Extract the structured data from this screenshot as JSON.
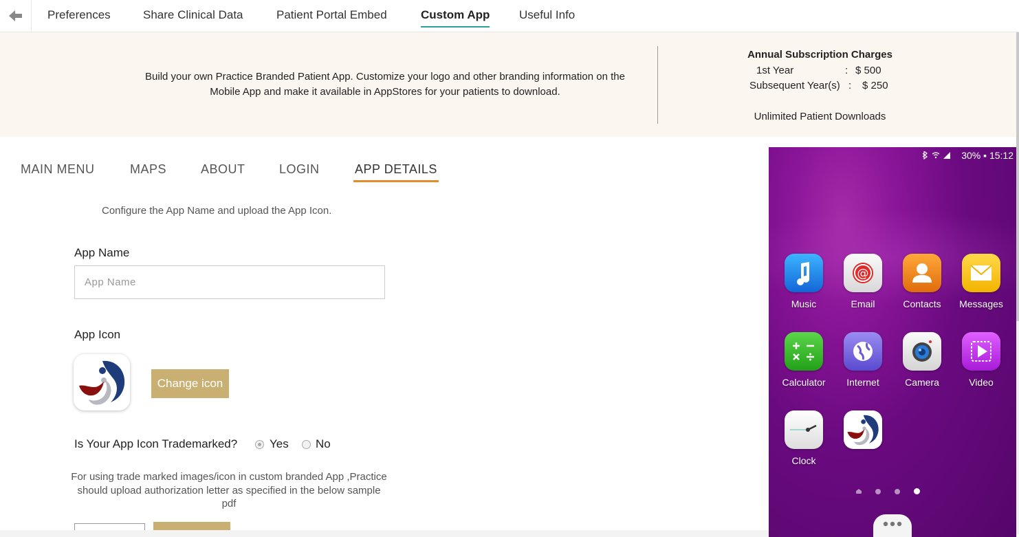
{
  "top_nav": {
    "tabs": [
      {
        "label": "Preferences"
      },
      {
        "label": "Share Clinical Data"
      },
      {
        "label": "Patient Portal Embed"
      },
      {
        "label": "Custom App"
      },
      {
        "label": "Useful Info"
      }
    ],
    "active_tab": "Custom App"
  },
  "banner": {
    "line1": "Build your own Practice Branded Patient App. Customize your logo and other branding information on the",
    "line2": "Mobile App and make it available in AppStores for your patients to download.",
    "pricing": {
      "title": "Annual Subscription Charges",
      "first_year_label": "1st Year",
      "first_year_sep": ":",
      "first_year_value": "$ 500",
      "subsequent_label": "Subsequent Year(s)",
      "subsequent_sep": ":",
      "subsequent_value": "$ 250",
      "downloads": "Unlimited Patient Downloads"
    }
  },
  "sub_tabs": {
    "items": [
      {
        "label": "MAIN MENU"
      },
      {
        "label": "MAPS"
      },
      {
        "label": "ABOUT"
      },
      {
        "label": "LOGIN"
      },
      {
        "label": "APP DETAILS"
      }
    ],
    "active": "APP DETAILS"
  },
  "app_details": {
    "description": "Configure the App Name and upload the App Icon.",
    "app_name_label": "App Name",
    "app_name_placeholder": "App Name",
    "app_name_value": "",
    "app_icon_label": "App Icon",
    "change_icon_label": "Change icon",
    "trademark_question": "Is Your App Icon Trademarked?",
    "trademark_yes": "Yes",
    "trademark_no": "No",
    "trademark_selected": "Yes",
    "trademark_note_1": "For using trade marked images/icon in custom branded App ,Practice",
    "trademark_note_2": "should upload authorization letter as specified in the below sample",
    "trademark_note_3": "pdf"
  },
  "phone_preview": {
    "status": "30% ▪ 15:12",
    "apps": [
      {
        "name": "Music",
        "icon": "music-note-icon",
        "color": "#1e90f0"
      },
      {
        "name": "Email",
        "icon": "at-sign-icon",
        "color": "#e8e8e8"
      },
      {
        "name": "Contacts",
        "icon": "person-icon",
        "color": "#f08a1c"
      },
      {
        "name": "Messages",
        "icon": "envelope-icon",
        "color": "#f7c21a"
      },
      {
        "name": "Calculator",
        "icon": "calculator-icon",
        "color": "#3cba2c"
      },
      {
        "name": "Internet",
        "icon": "globe-icon",
        "color": "#7a6ae0"
      },
      {
        "name": "Camera",
        "icon": "camera-icon",
        "color": "#e6e6e6"
      },
      {
        "name": "Video",
        "icon": "play-icon",
        "color": "#c83cf0"
      },
      {
        "name": "Clock",
        "icon": "clock-icon",
        "color": "#f2f2f2"
      },
      {
        "name": "",
        "icon": "custom-app-logo-icon",
        "color": "#ffffff"
      }
    ],
    "page_dots": 4,
    "active_page": 4
  },
  "colors": {
    "accent_teal": "#2aa198",
    "accent_orange": "#e8892a",
    "button_gold": "#c9b072",
    "banner_bg": "#fcf6f0"
  }
}
